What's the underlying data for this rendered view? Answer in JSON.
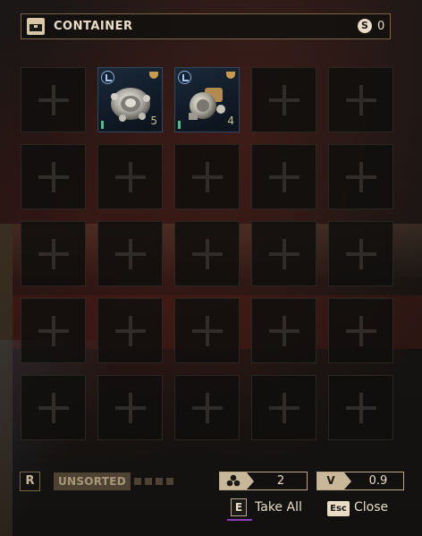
{
  "header": {
    "title": "CONTAINER",
    "currency_icon": "currency-s-icon",
    "currency_value": "0"
  },
  "grid": {
    "rows": 5,
    "columns": 5,
    "empty_slot_icon": "plus-icon",
    "items": [
      {
        "slot": 1,
        "name": "gear-wheel-part",
        "count": "5",
        "type_icon": "skill-badge-icon",
        "corner_icon": "drum-icon"
      },
      {
        "slot": 2,
        "name": "valve-part",
        "count": "4",
        "type_icon": "skill-badge-icon",
        "corner_icon": "drum-icon"
      }
    ]
  },
  "footer": {
    "sort_key": "R",
    "sort_label": "UNSORTED",
    "weight_value": "2",
    "volume_tag": "V",
    "volume_value": "0.9",
    "take_all_key": "E",
    "take_all_label": "Take All",
    "close_key": "Esc",
    "close_label": "Close"
  },
  "colors": {
    "accent_border": "#7a6644",
    "text": "#e8dcc6",
    "item_bg": "#1b2a3a",
    "highlight": "#8a3fb8"
  }
}
